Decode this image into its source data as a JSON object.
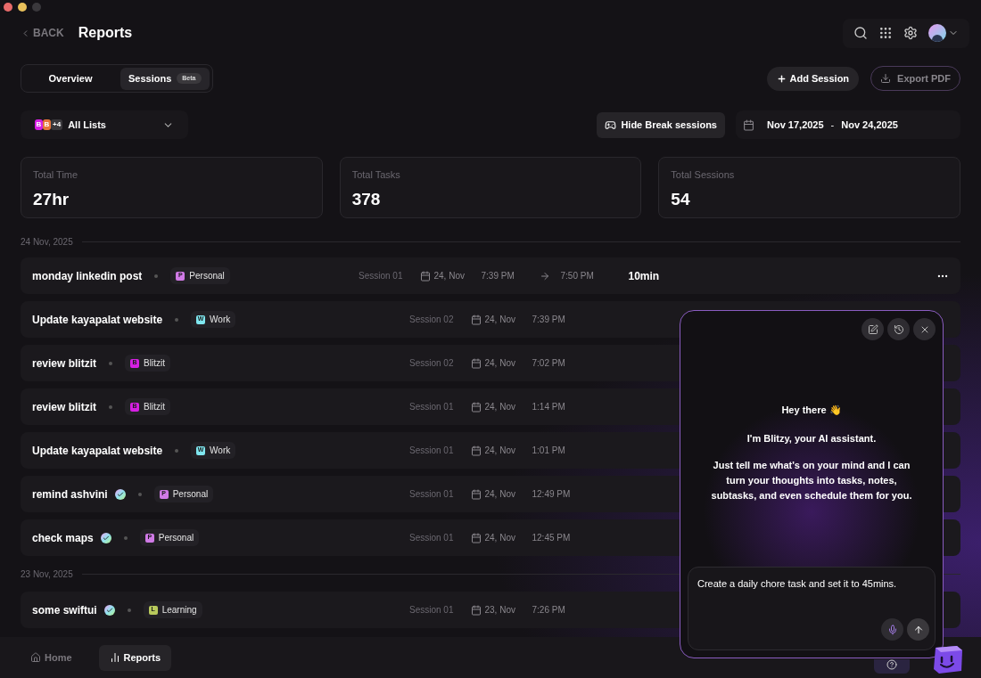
{
  "header": {
    "back": "BACK",
    "title": "Reports"
  },
  "tabs": [
    {
      "label": "Overview",
      "selected": false
    },
    {
      "label": "Sessions",
      "selected": true,
      "badge": "Beta"
    }
  ],
  "actions": {
    "add": "Add Session",
    "export": "Export PDF"
  },
  "list_filter": {
    "badges": [
      {
        "letter": "B",
        "color": "#d61fe3"
      },
      {
        "letter": "B",
        "color": "#e8763c"
      }
    ],
    "more": "+4",
    "label": "All Lists"
  },
  "break_toggle": "Hide Break sessions",
  "date_range": {
    "start": "Nov 17,2025",
    "separator": "-",
    "end": "Nov 24,2025"
  },
  "stats": [
    {
      "label": "Total Time",
      "value": "27hr"
    },
    {
      "label": "Total Tasks",
      "value": "378"
    },
    {
      "label": "Total Sessions",
      "value": "54"
    }
  ],
  "groups": [
    {
      "date": "24 Nov, 2025",
      "rows": [
        {
          "name": "monday linkedin post",
          "verified": false,
          "tag": {
            "letter": "P",
            "label": "Personal",
            "color": "#d07ae6"
          },
          "session": "Session 01",
          "date": "24, Nov",
          "start": "7:39 PM",
          "end": "7:50 PM",
          "duration": "10min"
        },
        {
          "name": "Update kayapalat website",
          "verified": false,
          "tag": {
            "letter": "W",
            "label": "Work",
            "color": "#7fe6ef"
          },
          "session": "Session 02",
          "date": "24, Nov",
          "start": "7:39 PM"
        },
        {
          "name": "review blitzit",
          "verified": false,
          "tag": {
            "letter": "B",
            "label": "Blitzit",
            "color": "#d61fe3"
          },
          "session": "Session 02",
          "date": "24, Nov",
          "start": "7:02 PM"
        },
        {
          "name": "review blitzit",
          "verified": false,
          "tag": {
            "letter": "B",
            "label": "Blitzit",
            "color": "#d61fe3"
          },
          "session": "Session 01",
          "date": "24, Nov",
          "start": "1:14 PM"
        },
        {
          "name": "Update kayapalat website",
          "verified": false,
          "tag": {
            "letter": "W",
            "label": "Work",
            "color": "#7fe6ef"
          },
          "session": "Session 01",
          "date": "24, Nov",
          "start": "1:01 PM"
        },
        {
          "name": "remind ashvini",
          "verified": true,
          "tag": {
            "letter": "P",
            "label": "Personal",
            "color": "#d07ae6"
          },
          "session": "Session 01",
          "date": "24, Nov",
          "start": "12:49 PM"
        },
        {
          "name": "check maps",
          "verified": true,
          "tag": {
            "letter": "P",
            "label": "Personal",
            "color": "#d07ae6"
          },
          "session": "Session 01",
          "date": "24, Nov",
          "start": "12:45 PM"
        }
      ]
    },
    {
      "date": "23 Nov, 2025",
      "rows": [
        {
          "name": "some swiftui",
          "verified": true,
          "tag": {
            "letter": "L",
            "label": "Learning",
            "color": "#b8c95c"
          },
          "session": "Session 01",
          "date": "23, Nov",
          "start": "7:26 PM"
        }
      ]
    }
  ],
  "nav": [
    {
      "kind": "home",
      "label": "Home",
      "selected": false
    },
    {
      "kind": "reports",
      "label": "Reports",
      "selected": true
    }
  ],
  "assistant": {
    "greeting": "Hey there 👋",
    "intro": "I'm Blitzy, your AI assistant.",
    "body": "Just tell me what's on your mind and I can turn your thoughts into tasks, notes, subtasks, and even schedule them for you.",
    "input": "Create a daily chore task and set it to 45mins."
  }
}
